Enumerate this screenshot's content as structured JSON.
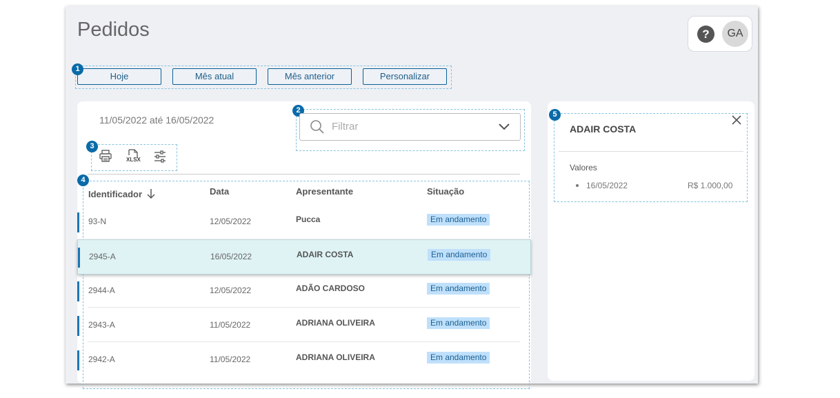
{
  "page": {
    "title": "Pedidos"
  },
  "header": {
    "help_icon": "question-circle-icon",
    "avatar_initials": "GA"
  },
  "markers": [
    "1",
    "2",
    "3",
    "4",
    "5"
  ],
  "periods": [
    "Hoje",
    "Mês atual",
    "Mês anterior",
    "Personalizar"
  ],
  "list": {
    "date_range": "11/05/2022 até 16/05/2022",
    "filter_placeholder": "Filtrar",
    "tools": [
      "print-icon",
      "xlsx-export-icon",
      "sliders-icon"
    ],
    "xlsx_label": "XLSX",
    "columns": {
      "id": "Identificador",
      "date": "Data",
      "presenter": "Apresentante",
      "status": "Situação"
    },
    "rows": [
      {
        "id": "93-N",
        "date": "12/05/2022",
        "presenter": "Pucca",
        "status": "Em andamento"
      },
      {
        "id": "2945-A",
        "date": "16/05/2022",
        "presenter": "ADAIR COSTA",
        "status": "Em andamento"
      },
      {
        "id": "2944-A",
        "date": "12/05/2022",
        "presenter": "ADÃO CARDOSO",
        "status": "Em andamento"
      },
      {
        "id": "2943-A",
        "date": "11/05/2022",
        "presenter": "ADRIANA OLIVEIRA",
        "status": "Em andamento"
      },
      {
        "id": "2942-A",
        "date": "11/05/2022",
        "presenter": "ADRIANA OLIVEIRA",
        "status": "Em andamento"
      }
    ]
  },
  "detail": {
    "name": "ADAIR COSTA",
    "values_label": "Valores",
    "values": [
      {
        "date": "16/05/2022",
        "amount": "R$ 1.000,00"
      }
    ]
  },
  "colors": {
    "accent": "#0a6aa9",
    "status_bg": "#bfe0fb",
    "selected_row": "#dff3f5"
  }
}
